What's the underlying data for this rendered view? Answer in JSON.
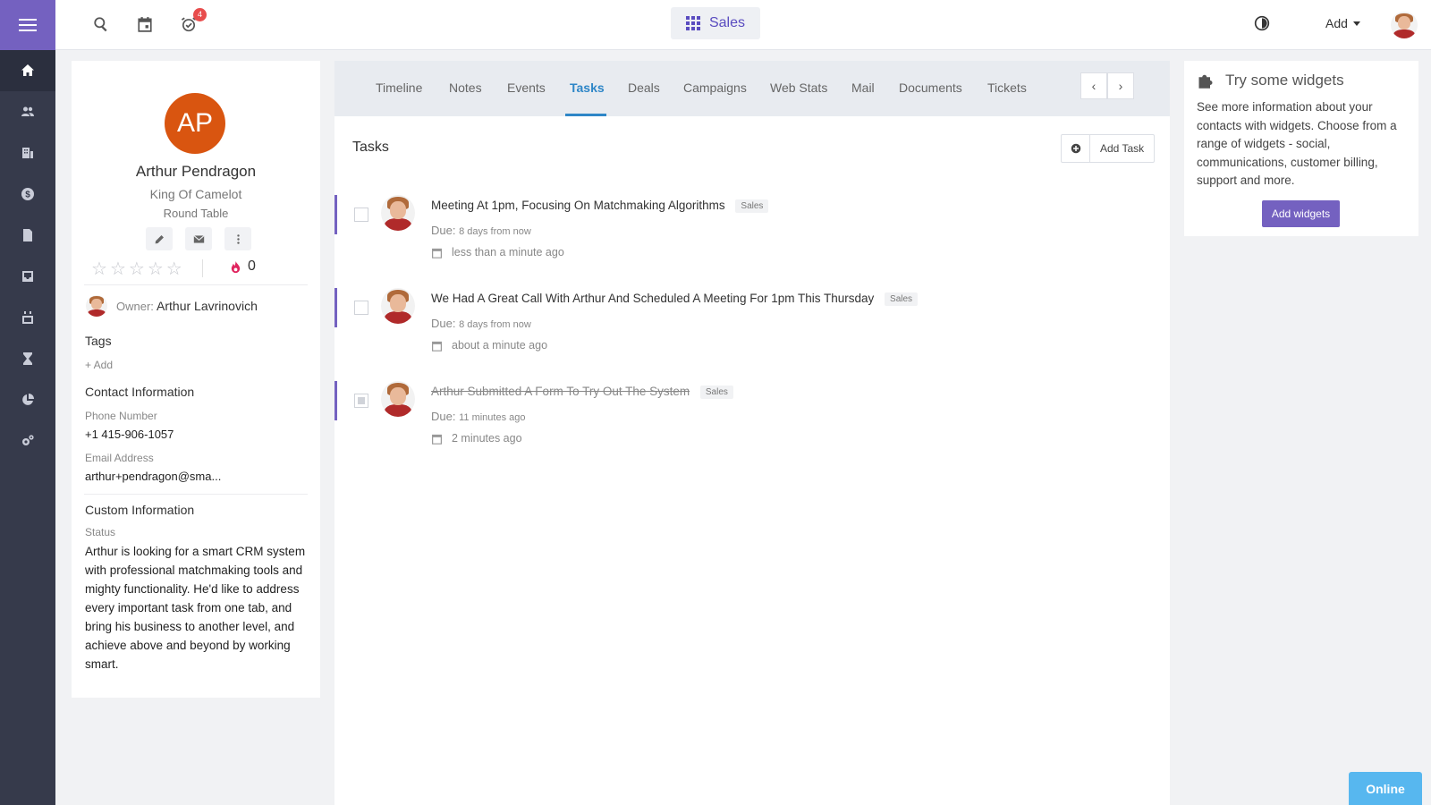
{
  "topbar": {
    "notification_count": "4",
    "app_switch_label": "Sales",
    "add_label": "Add"
  },
  "contact": {
    "initials": "AP",
    "name": "Arthur Pendragon",
    "title": "King Of Camelot",
    "company": "Round Table",
    "rating": 0,
    "rating_max": 5,
    "score": "0",
    "owner_label": "Owner:",
    "owner_name": "Arthur Lavrinovich",
    "tags_heading": "Tags",
    "tags_add": "+ Add",
    "contact_info_heading": "Contact Information",
    "phone_label": "Phone Number",
    "phone": "+1 415-906-1057",
    "email_label": "Email Address",
    "email": "arthur+pendragon@sma...",
    "custom_info_heading": "Custom Information",
    "status_label": "Status",
    "status_text": "Arthur is looking for a smart CRM system with professional matchmaking tools and mighty functionality. He'd like to address every important task from one tab, and bring his business to another level, and achieve above and beyond by working smart."
  },
  "tabs": [
    "Timeline",
    "Notes",
    "Events",
    "Tasks",
    "Deals",
    "Campaigns",
    "Web Stats",
    "Mail",
    "Documents",
    "Tickets"
  ],
  "active_tab": "Tasks",
  "tasks_section": {
    "heading": "Tasks",
    "add_button": "Add Task",
    "due_label": "Due:",
    "items": [
      {
        "title": "Meeting At 1pm, Focusing On Matchmaking Algorithms",
        "tag": "Sales",
        "due": "8 days from now",
        "created": "less than a minute ago",
        "completed": false
      },
      {
        "title": "We Had A Great Call With Arthur And Scheduled A Meeting For 1pm This Thursday",
        "tag": "Sales",
        "due": "8 days from now",
        "created": "about a minute ago",
        "completed": false
      },
      {
        "title": "Arthur Submitted A Form To Try Out The System",
        "tag": "Sales",
        "due": "11 minutes ago",
        "created": "2 minutes ago",
        "completed": true
      }
    ]
  },
  "widget": {
    "heading": "Try some widgets",
    "text": "See more information about your contacts with widgets. Choose from a range of widgets - social, communications, customer billing, support and more.",
    "button": "Add widgets"
  },
  "online_label": "Online",
  "colors": {
    "nav_bg": "#363a4b",
    "accent_purple": "#7461c0",
    "tab_active": "#2e86c7",
    "avatar_orange": "#d95510",
    "online_blue": "#57b7ef"
  },
  "icons": {
    "leftnav": [
      "menu-icon",
      "home-icon",
      "contacts-icon",
      "companies-icon",
      "deals-icon",
      "documents-icon",
      "inbox-icon",
      "calendar-icon",
      "tasks-icon",
      "reports-icon",
      "settings-icon"
    ],
    "topbar": [
      "search-icon",
      "calendar-icon",
      "alarm-icon",
      "theme-toggle-icon"
    ]
  }
}
